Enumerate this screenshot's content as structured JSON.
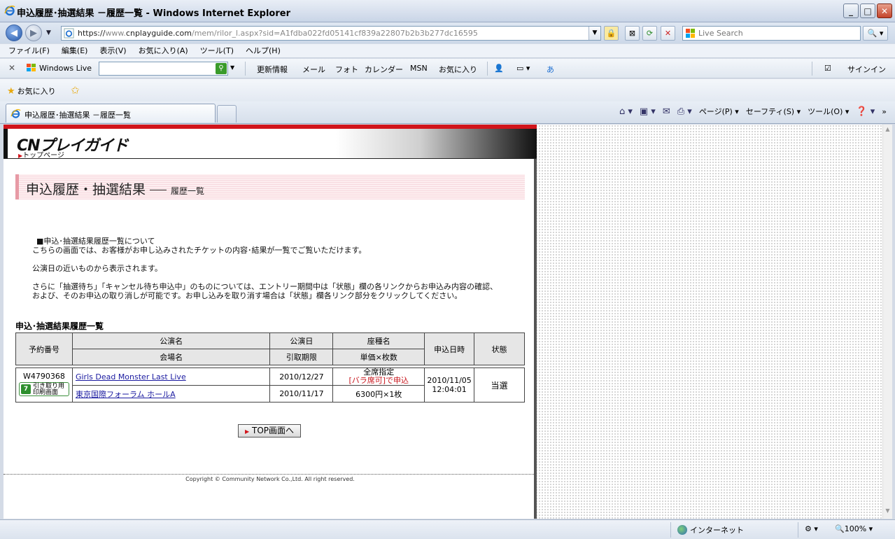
{
  "window": {
    "title": "申込履歴･抽選結果 －履歴一覧 - Windows Internet Explorer",
    "min_label": "_",
    "max_label": "□",
    "close_label": "✕"
  },
  "address": {
    "url_secure_prefix": "https://",
    "url_www": "www.",
    "url_host": "cnplayguide.com",
    "url_path": "/mem/rilor_l.aspx?sid=A1fdba022fd05141cf839a22807b2b3b277dc16595",
    "search_placeholder": "Live Search"
  },
  "menu": {
    "items": [
      "ファイル(F)",
      "編集(E)",
      "表示(V)",
      "お気に入り(A)",
      "ツール(T)",
      "ヘルプ(H)"
    ]
  },
  "livebar": {
    "brand": "Windows Live",
    "items": [
      "更新情報",
      "メール",
      "フォト",
      "カレンダー",
      "MSN",
      "お気に入り"
    ],
    "signin": "サインイン"
  },
  "favorites": {
    "label": "お気に入り"
  },
  "tabs": {
    "active_title": "申込履歴･抽選結果 －履歴一覧"
  },
  "commandbar": {
    "page": "ページ(P)",
    "safety": "セーフティ(S)",
    "tools": "ツール(O)"
  },
  "site": {
    "logo": "CNプレイガイド",
    "toppage": "トップページ",
    "heading": "申込履歴・抽選結果",
    "subheading": "履歴一覧",
    "intro": [
      "■申込･抽選結果履歴一覧について",
      "こちらの画面では、お客様がお申し込みされたチケットの内容･結果が一覧でご覧いただけます。",
      "公演日の近いものから表示されます。",
      "さらに「抽選待ち」「キャンセル待ち申込中」のものについては、エントリー期間中は「状態」欄の各リンクからお申込み内容の確認、",
      "および、そのお申込の取り消しが可能です。お申し込みを取り消す場合は「状態」欄各リンク部分をクリックしてください。"
    ],
    "list_title": "申込･抽選結果履歴一覧",
    "table_headers": {
      "reservation_no": "予約番号",
      "show_name": "公演名",
      "venue": "会場名",
      "show_date": "公演日",
      "pickup_deadline": "引取期限",
      "seat_type": "座種名",
      "price_qty": "単価×枚数",
      "applied_at": "申込日時",
      "status": "状態"
    },
    "rows": [
      {
        "reservation_no": "W4790368",
        "pickup_line1": "引き取り用",
        "pickup_line2": "印刷画面",
        "seven_mark": "7",
        "show_name": "Girls Dead Monster Last Live",
        "venue": "東京国際フォーラム ホールA",
        "show_date": "2010/12/27",
        "pickup_deadline": "2010/11/17",
        "seat_type": "全席指定",
        "seat_note": "[バラ席可]で申込",
        "price_qty": "6300円×1枚",
        "applied_date": "2010/11/05",
        "applied_time": "12:04:01",
        "status": "当選"
      }
    ],
    "top_button": "TOP画面へ",
    "copyright": "Copyright © Community Network Co.,Ltd. All right reserved."
  },
  "status": {
    "zone": "インターネット",
    "zoom": "100%"
  },
  "colors": {
    "brand_red": "#d1141b",
    "link": "#1a1aa0",
    "heading_band": "#fdeef0"
  }
}
